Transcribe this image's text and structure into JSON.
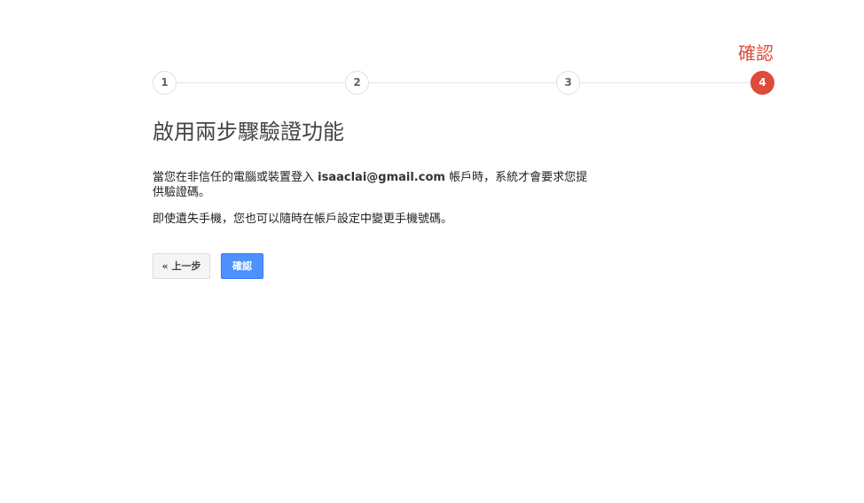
{
  "stepper": {
    "current_title": "確認",
    "steps": [
      "1",
      "2",
      "3",
      "4"
    ],
    "active_step": 4
  },
  "heading": "啟用兩步驟驗證功能",
  "description": {
    "prefix": "當您在非信任的電腦或裝置登入 ",
    "email": "isaaclai@gmail.com",
    "suffix": " 帳戶時，系統才會要求您提供驗證碼。"
  },
  "note": "即使遺失手機，您也可以隨時在帳戶設定中變更手機號碼。",
  "buttons": {
    "back_label": "« 上一步",
    "confirm_label": "確認"
  },
  "colors": {
    "accent": "#dd4b39",
    "primary_button": "#4d90fe"
  }
}
